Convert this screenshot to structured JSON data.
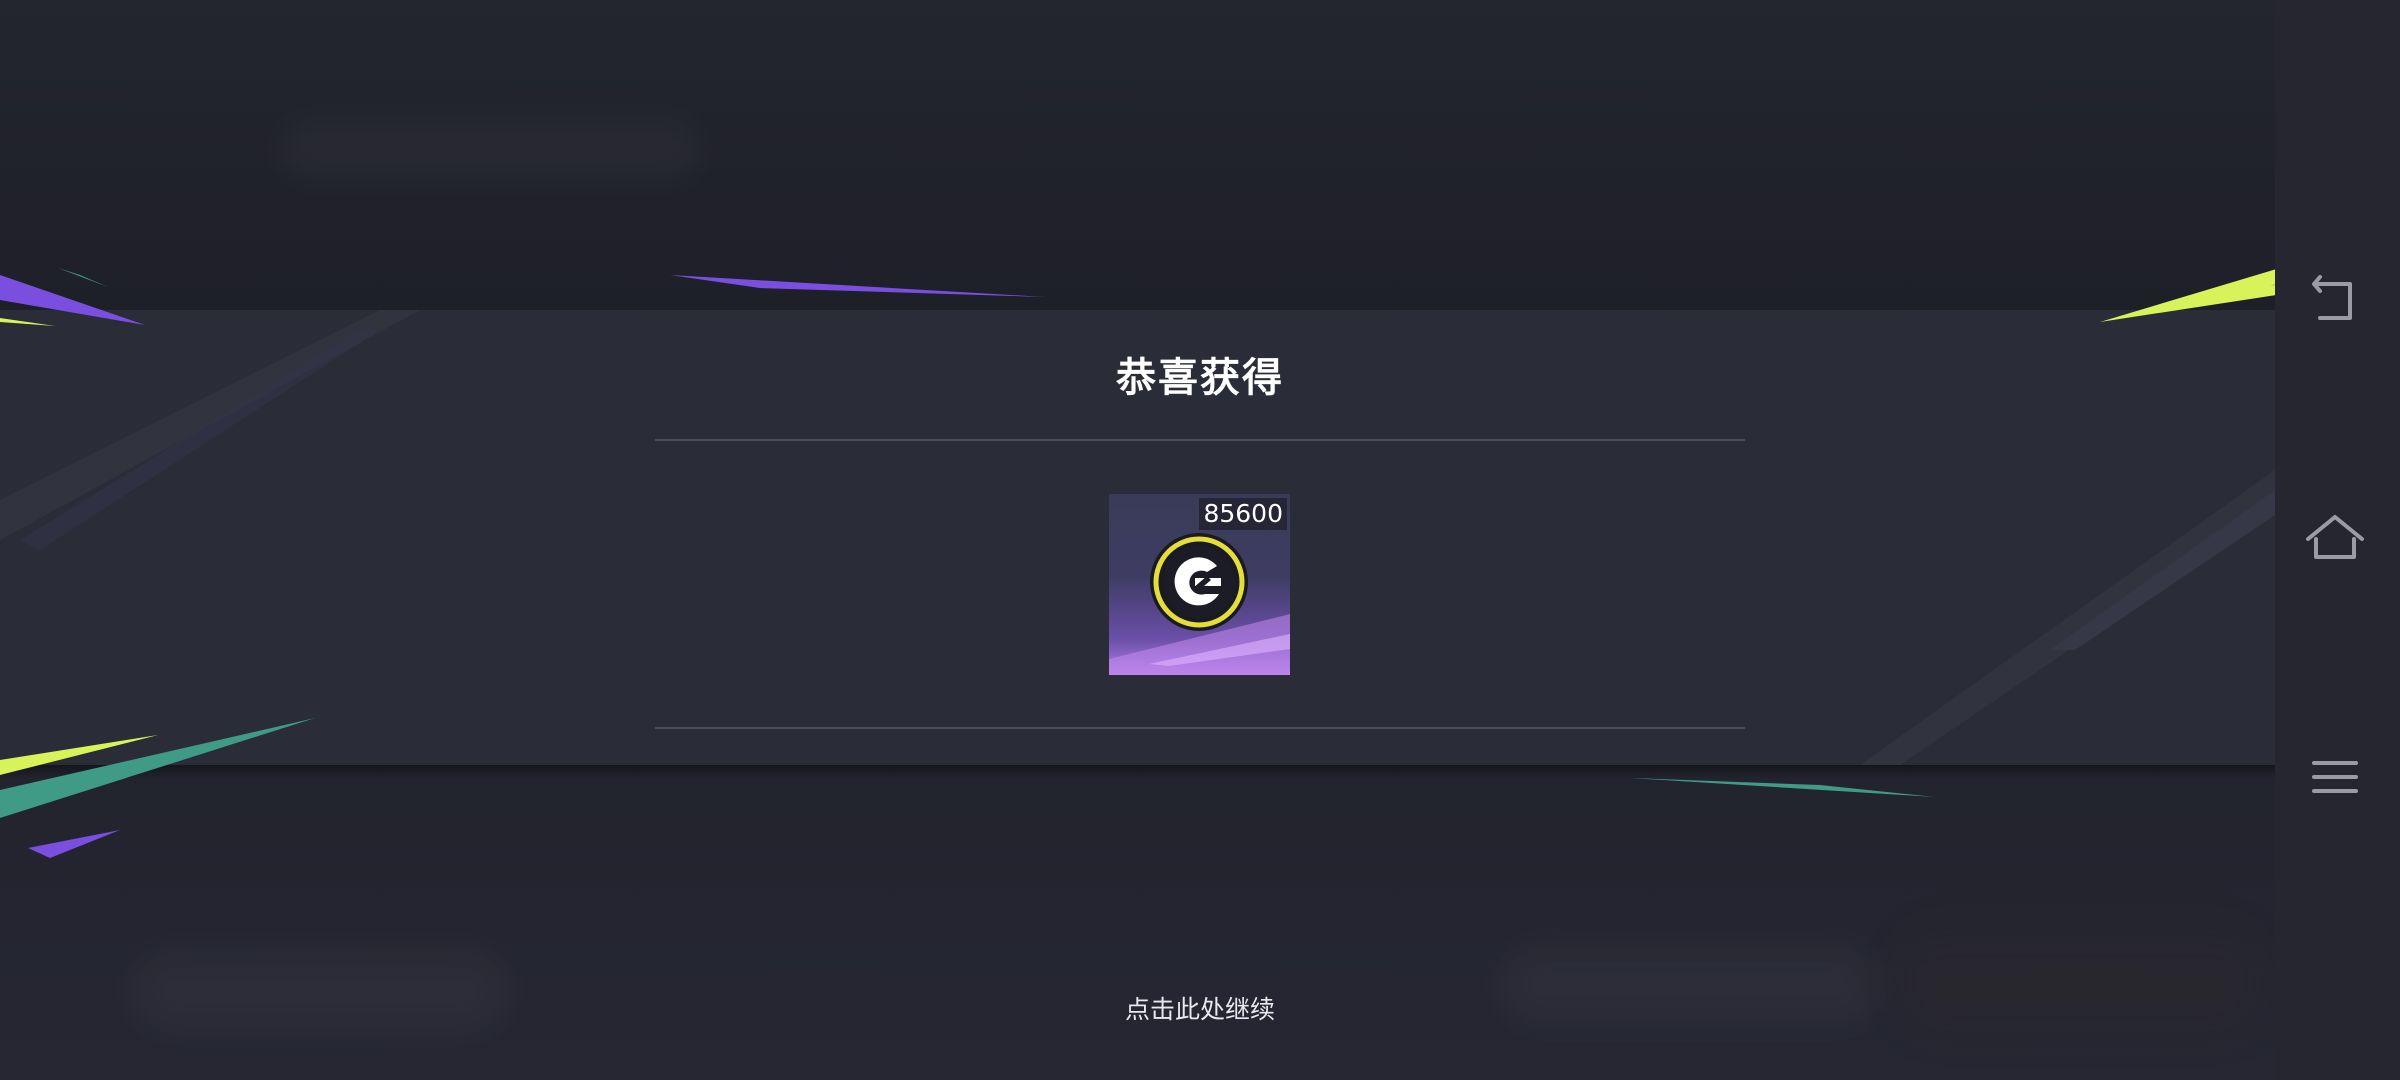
{
  "dialog": {
    "title": "恭喜获得",
    "reward": {
      "quantity": "85600",
      "icon": "coin-icon"
    },
    "continue_label": "点击此处继续"
  },
  "nav": {
    "back_icon": "back-icon",
    "home_icon": "home-icon",
    "menu_icon": "menu-icon"
  },
  "colors": {
    "purple_streak": "#7a4fe0",
    "green_streak": "#3f9a86",
    "lime_streak": "#d8f25a",
    "coin_ring": "#e4dd3a"
  }
}
